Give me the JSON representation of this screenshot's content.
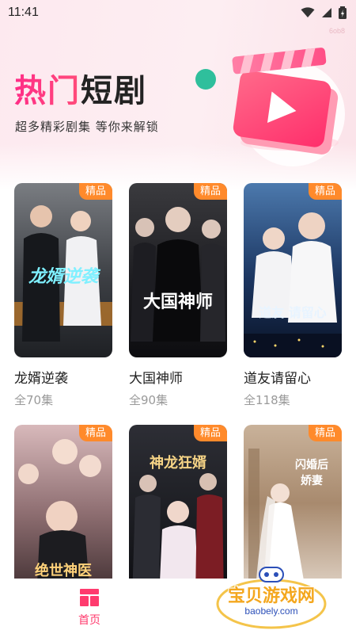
{
  "status_bar": {
    "time": "11:41"
  },
  "device_tag": "6ob8",
  "hero": {
    "title_highlight": "热门",
    "title_rest": "短剧",
    "subtitle": "超多精彩剧集 等你来解锁"
  },
  "dramas": [
    {
      "title": "龙婿逆袭",
      "episodes": "全70集",
      "badge": "精品",
      "poster_text": "龙婿逆袭",
      "colors": [
        "#6b6e72",
        "#2b2e33"
      ]
    },
    {
      "title": "大国神师",
      "episodes": "全90集",
      "badge": "精品",
      "poster_text": "大国神师",
      "colors": [
        "#3a3a3e",
        "#0f0f12"
      ]
    },
    {
      "title": "道友请留心",
      "episodes": "全118集",
      "badge": "精品",
      "poster_text": "道友 请留心",
      "colors": [
        "#3b5f8e",
        "#0b1730"
      ]
    },
    {
      "title": "",
      "episodes": "",
      "badge": "精品",
      "poster_text": "绝世神医",
      "colors": [
        "#c9a3a6",
        "#3b2b2d"
      ]
    },
    {
      "title": "",
      "episodes": "",
      "badge": "精品",
      "poster_text": "神龙狂婿",
      "colors": [
        "#3b3c44",
        "#15161b"
      ]
    },
    {
      "title": "",
      "episodes": "",
      "badge": "精品",
      "poster_text": "闪婚后 娇妻",
      "colors": [
        "#b69a7e",
        "#e8ddd2"
      ]
    }
  ],
  "bottom_nav": {
    "home_label": "首页"
  },
  "watermark": {
    "text": "宝贝游戏网",
    "url": "baobely.com"
  },
  "theme": {
    "accent": "#ff3b6e",
    "badge": "#ff8a2b"
  }
}
